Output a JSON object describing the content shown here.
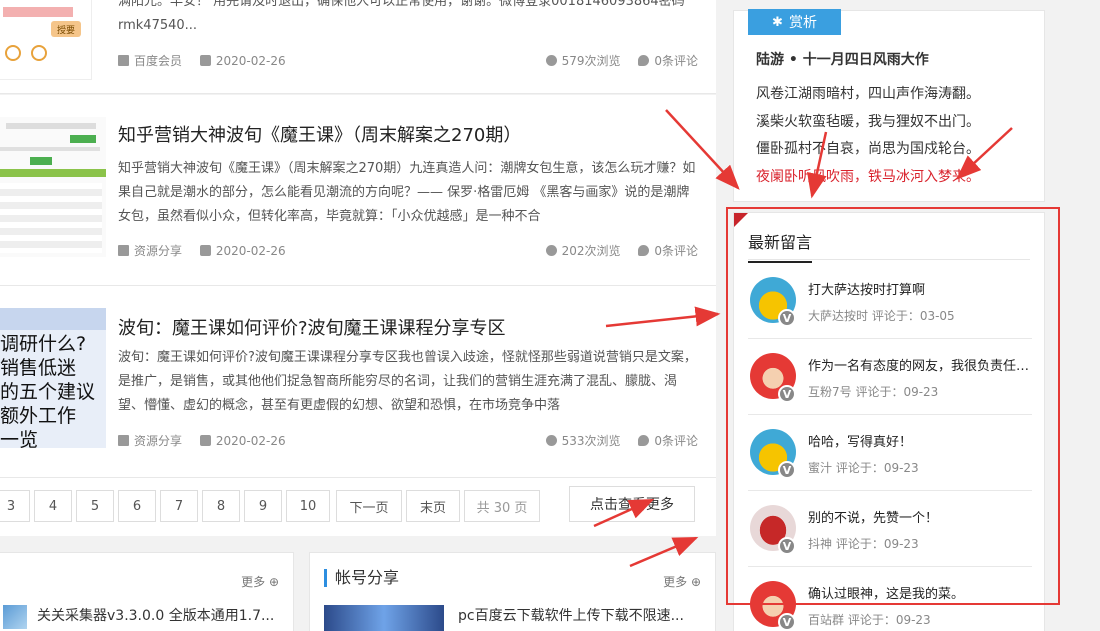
{
  "posts": [
    {
      "excerpt": "满阳光。早安！   用完请及时退出，确保他人可以正常使用，谢谢。微博登录0018146093864密码rmk47540...",
      "category": "百度会员",
      "date": "2020-02-26",
      "views": "579次浏览",
      "comments": "0条评论",
      "thumb_button": "授要"
    },
    {
      "title": "知乎营销大神波旬《魔王课》（周末解案之270期）",
      "excerpt": "知乎营销大神波旬《魔王课》（周末解案之270期）九连真造人问：潮牌女包生意，该怎么玩才赚？如果自己就是潮水的部分，怎么能看见潮流的方向呢？—— 保罗·格雷厄姆 《黑客与画家》说的是潮牌女包，虽然看似小众，但转化率高，毕竟就算：「小众优越感」是一种不合",
      "category": "资源分享",
      "date": "2020-02-26",
      "views": "202次浏览",
      "comments": "0条评论"
    },
    {
      "title": "波旬：魔王课如何评价?波旬魔王课课程分享专区",
      "excerpt": "波旬：魔王课如何评价?波旬魔王课课程分享专区我也曾误入歧途，怪就怪那些弱道说营销只是文案，是推广，是销售，或其他他们捉急智商所能穷尽的名词，让我们的营销生涯充满了混乱、朦胧、渴望、懵懂、虚幻的概念，甚至有更虚假的幻想、欲望和恐惧，在市场竞争中落",
      "category": "资源分享",
      "date": "2020-02-26",
      "views": "533次浏览",
      "comments": "0条评论",
      "thumb_lines": [
        "调研什么?",
        "销售低迷",
        "的五个建议",
        "额外工作",
        "一览"
      ]
    }
  ],
  "pager": {
    "pages": [
      "3",
      "4",
      "5",
      "6",
      "7",
      "8",
      "9",
      "10"
    ],
    "next": "下一页",
    "last": "末页",
    "total": "共 30 页",
    "more": "点击查看更多"
  },
  "boxes": [
    {
      "more": "更多",
      "item": "关关采集器v3.3.0.0 全版本通用1.7..."
    },
    {
      "title": "帐号分享",
      "more": "更多",
      "item": "pc百度云下载软件上传下载不限速..."
    }
  ],
  "poem": {
    "tag": "赏析",
    "title": "陆游 • 十一月四日风雨大作",
    "lines": [
      "风卷江湖雨暗村，四山声作海涛翻。",
      "溪柴火软蛮毡暖，我与狸奴不出门。",
      "僵卧孤村不自哀，尚思为国戍轮台。",
      "夜阑卧听风吹雨，铁马冰河入梦来。"
    ]
  },
  "latest": {
    "title": "最新留言",
    "comments": [
      {
        "text": "打大萨达按时打算啊",
        "sub": "大萨达按时 评论于：03-05",
        "avatar": "yellow-bird"
      },
      {
        "text": "作为一名有态度的网友，我很负责任地点赞",
        "sub": "互粉7号 评论于：09-23",
        "avatar": "red-cat"
      },
      {
        "text": "哈哈，写得真好！",
        "sub": "蜜汁 评论于：09-23",
        "avatar": "yellow-bird"
      },
      {
        "text": "别的不说，先赞一个！",
        "sub": "抖神 评论于：09-23",
        "avatar": "red-lips"
      },
      {
        "text": "确认过眼神，这是我的菜。",
        "sub": "百站群 评论于：09-23",
        "avatar": "red-cat"
      }
    ],
    "badge": "V"
  },
  "colors": {
    "accent": "#3a9fe0",
    "annotation_red": "#e53935",
    "poem_red": "#d9232d"
  }
}
